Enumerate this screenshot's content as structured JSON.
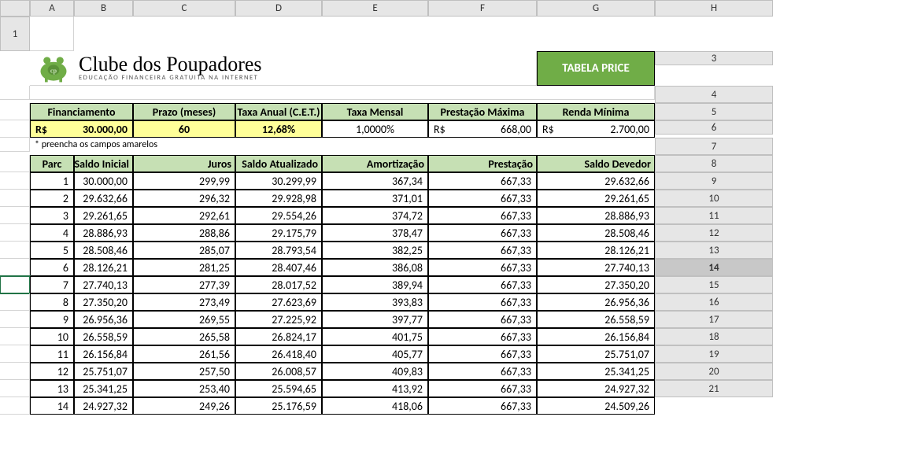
{
  "columns": [
    "",
    "A",
    "B",
    "C",
    "D",
    "E",
    "F",
    "G",
    "H"
  ],
  "rowHeaders": [
    1,
    3,
    4,
    5,
    6,
    7,
    8,
    9,
    10,
    11,
    12,
    13,
    14,
    15,
    16,
    17,
    18,
    19,
    20,
    21
  ],
  "selectedRow": 14,
  "logo": {
    "title": "Clube dos Poupadores",
    "subtitle": "EDUCAÇÃO FINANCEIRA GRATUITA NA INTERNET"
  },
  "badge": "TABELA PRICE",
  "inputHeaders": {
    "financiamento": "Financiamento",
    "prazo": "Prazo (meses)",
    "taxaAnual": "Taxa Anual (C.E.T.)",
    "taxaMensal": "Taxa Mensal",
    "prestMax": "Prestação Máxima",
    "rendaMin": "Renda Mínima"
  },
  "inputValues": {
    "financ_prefix": "R$",
    "financ_val": "30.000,00",
    "prazo": "60",
    "taxaAnual": "12,68%",
    "taxaMensal": "1,0000%",
    "prestMax_prefix": "R$",
    "prestMax_val": "668,00",
    "rendaMin_prefix": "R$",
    "rendaMin_val": "2.700,00"
  },
  "note": "* preencha os campos amarelos",
  "tableHeaders": {
    "parc": "Parc",
    "saldoIni": "Saldo Inicial",
    "juros": "Juros",
    "saldoAtu": "Saldo Atualizado",
    "amort": "Amortização",
    "prest": "Prestação",
    "saldoDev": "Saldo Devedor"
  },
  "rows": [
    {
      "n": "1",
      "si": "30.000,00",
      "j": "299,99",
      "sa": "30.299,99",
      "a": "367,34",
      "p": "667,33",
      "sd": "29.632,66"
    },
    {
      "n": "2",
      "si": "29.632,66",
      "j": "296,32",
      "sa": "29.928,98",
      "a": "371,01",
      "p": "667,33",
      "sd": "29.261,65"
    },
    {
      "n": "3",
      "si": "29.261,65",
      "j": "292,61",
      "sa": "29.554,26",
      "a": "374,72",
      "p": "667,33",
      "sd": "28.886,93"
    },
    {
      "n": "4",
      "si": "28.886,93",
      "j": "288,86",
      "sa": "29.175,79",
      "a": "378,47",
      "p": "667,33",
      "sd": "28.508,46"
    },
    {
      "n": "5",
      "si": "28.508,46",
      "j": "285,07",
      "sa": "28.793,54",
      "a": "382,25",
      "p": "667,33",
      "sd": "28.126,21"
    },
    {
      "n": "6",
      "si": "28.126,21",
      "j": "281,25",
      "sa": "28.407,46",
      "a": "386,08",
      "p": "667,33",
      "sd": "27.740,13"
    },
    {
      "n": "7",
      "si": "27.740,13",
      "j": "277,39",
      "sa": "28.017,52",
      "a": "389,94",
      "p": "667,33",
      "sd": "27.350,20"
    },
    {
      "n": "8",
      "si": "27.350,20",
      "j": "273,49",
      "sa": "27.623,69",
      "a": "393,83",
      "p": "667,33",
      "sd": "26.956,36"
    },
    {
      "n": "9",
      "si": "26.956,36",
      "j": "269,55",
      "sa": "27.225,92",
      "a": "397,77",
      "p": "667,33",
      "sd": "26.558,59"
    },
    {
      "n": "10",
      "si": "26.558,59",
      "j": "265,58",
      "sa": "26.824,17",
      "a": "401,75",
      "p": "667,33",
      "sd": "26.156,84"
    },
    {
      "n": "11",
      "si": "26.156,84",
      "j": "261,56",
      "sa": "26.418,40",
      "a": "405,77",
      "p": "667,33",
      "sd": "25.751,07"
    },
    {
      "n": "12",
      "si": "25.751,07",
      "j": "257,50",
      "sa": "26.008,57",
      "a": "409,83",
      "p": "667,33",
      "sd": "25.341,25"
    },
    {
      "n": "13",
      "si": "25.341,25",
      "j": "253,40",
      "sa": "25.594,65",
      "a": "413,92",
      "p": "667,33",
      "sd": "24.927,32"
    },
    {
      "n": "14",
      "si": "24.927,32",
      "j": "249,26",
      "sa": "25.176,59",
      "a": "418,06",
      "p": "667,33",
      "sd": "24.509,26"
    }
  ]
}
